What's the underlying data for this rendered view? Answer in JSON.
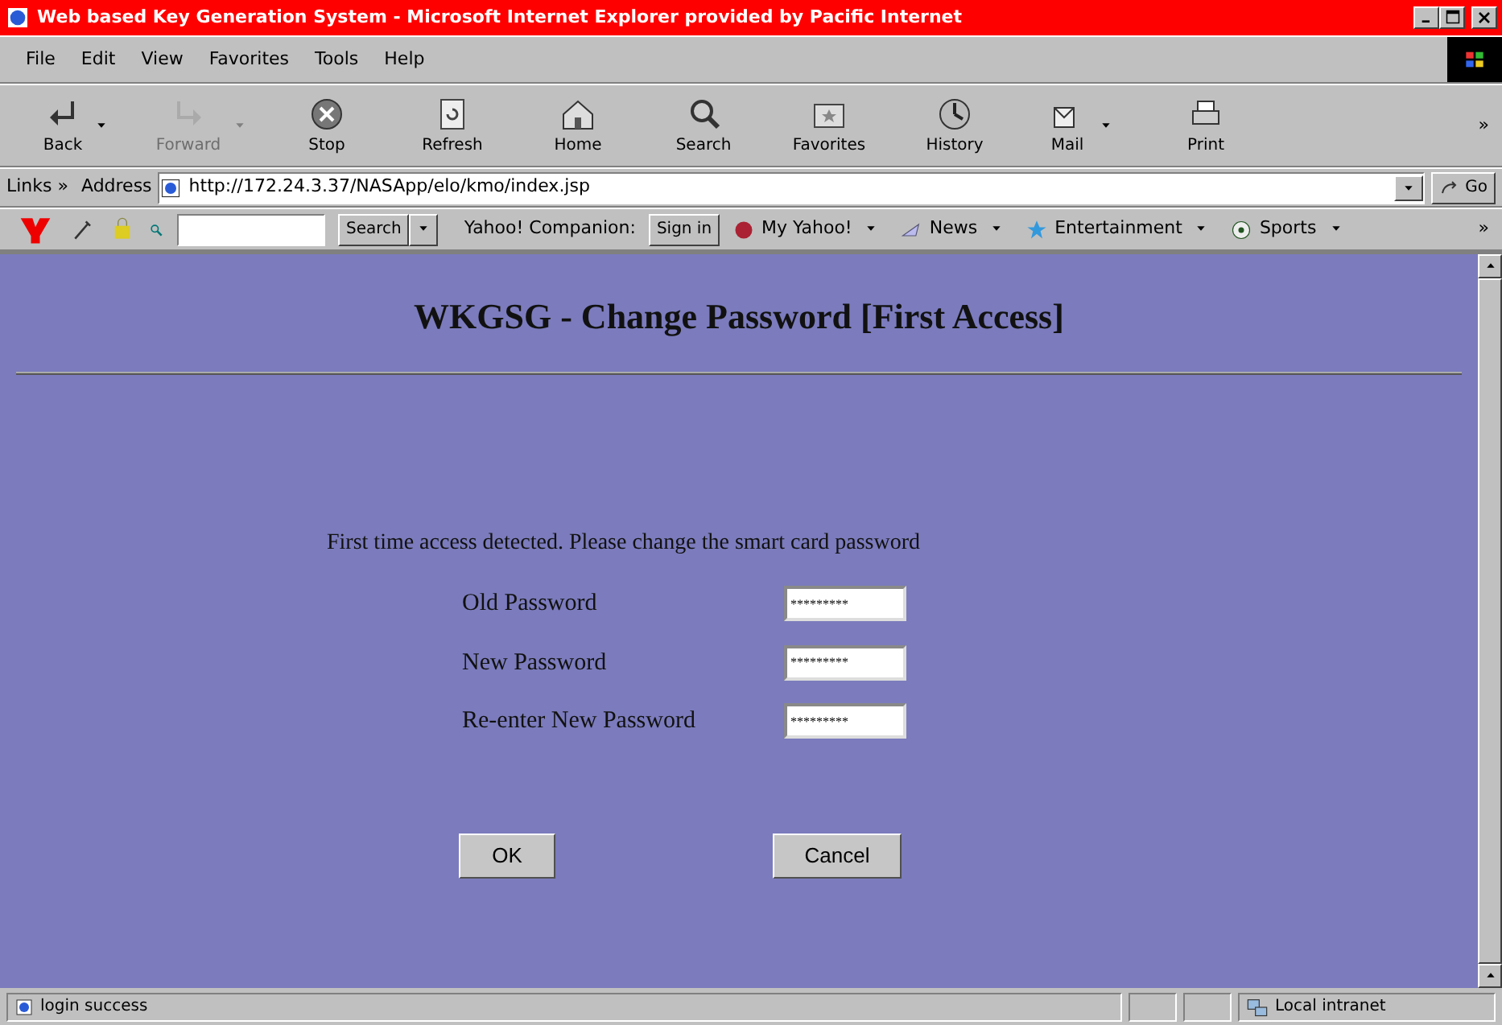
{
  "window": {
    "title": "Web based Key Generation System - Microsoft Internet Explorer provided by Pacific Internet"
  },
  "menu": [
    "File",
    "Edit",
    "View",
    "Favorites",
    "Tools",
    "Help"
  ],
  "toolbar": [
    {
      "label": "Back",
      "kind": "back",
      "disabled": false,
      "dropdown": true
    },
    {
      "label": "Forward",
      "kind": "forward",
      "disabled": true,
      "dropdown": true
    },
    {
      "label": "Stop",
      "kind": "stop",
      "disabled": false,
      "dropdown": false
    },
    {
      "label": "Refresh",
      "kind": "refresh",
      "disabled": false,
      "dropdown": false
    },
    {
      "label": "Home",
      "kind": "home",
      "disabled": false,
      "dropdown": false
    },
    {
      "label": "Search",
      "kind": "search",
      "disabled": false,
      "dropdown": false
    },
    {
      "label": "Favorites",
      "kind": "favorites",
      "disabled": false,
      "dropdown": false
    },
    {
      "label": "History",
      "kind": "history",
      "disabled": false,
      "dropdown": false
    },
    {
      "label": "Mail",
      "kind": "mail",
      "disabled": false,
      "dropdown": true
    },
    {
      "label": "Print",
      "kind": "print",
      "disabled": false,
      "dropdown": false
    }
  ],
  "toolbar_more": "»",
  "address_bar": {
    "links_label": "Links »",
    "label": "Address",
    "url": "http://172.24.3.37/NASApp/elo/kmo/index.jsp",
    "go": "Go"
  },
  "yahoo_bar": {
    "search_button": "Search",
    "companion_label": "Yahoo! Companion:",
    "sign_in": "Sign in",
    "links": [
      "My Yahoo!",
      "News",
      "Entertainment",
      "Sports"
    ],
    "more": "»"
  },
  "page": {
    "heading": "WKGSG - Change Password [First Access]",
    "message": "First time access detected. Please change the smart card password",
    "fields": [
      {
        "label": "Old Password",
        "value": "*********"
      },
      {
        "label": "New Password",
        "value": "*********"
      },
      {
        "label": "Re-enter New Password",
        "value": "*********"
      }
    ],
    "buttons": [
      "OK",
      "Cancel"
    ]
  },
  "status_bar": {
    "text": "login success",
    "zone": "Local intranet"
  }
}
